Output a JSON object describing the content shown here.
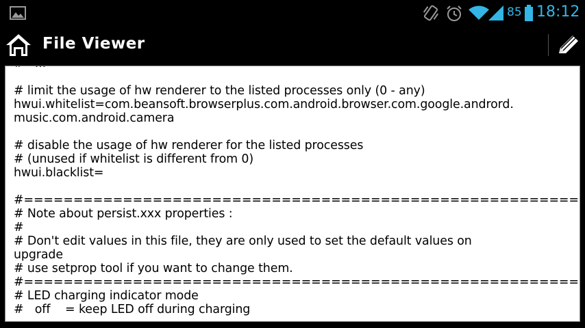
{
  "status_bar": {
    "battery_level": "85",
    "clock": "18:12",
    "icons": [
      "gallery-icon",
      "vibrate-icon",
      "alarm-icon",
      "wifi-icon",
      "signal-icon",
      "battery-icon"
    ],
    "accent_color": "#33b5e5"
  },
  "action_bar": {
    "title": "File Viewer",
    "icons": [
      "home-icon",
      "pencil-icon"
    ]
  },
  "file_content": {
    "lines": [
      "#   ...",
      "",
      "# limit the usage of hw renderer to the listed processes only (0 - any)",
      "hwui.whitelist=com.beansoft.browserplus.com.android.browser.com.google.andrord.",
      "music.com.android.camera",
      "",
      "# disable the usage of hw renderer for the listed processes",
      "# (unused if whitelist is different from 0)",
      "hwui.blacklist=",
      "",
      "#=================================================================================",
      "# Note about persist.xxx properties :",
      "#",
      "# Don't edit values in this file, they are only used to set the default values on",
      "upgrade",
      "# use setprop tool if you want to change them.",
      "#=================================================================================",
      "# LED charging indicator mode",
      "#   off    = keep LED off during charging"
    ]
  }
}
